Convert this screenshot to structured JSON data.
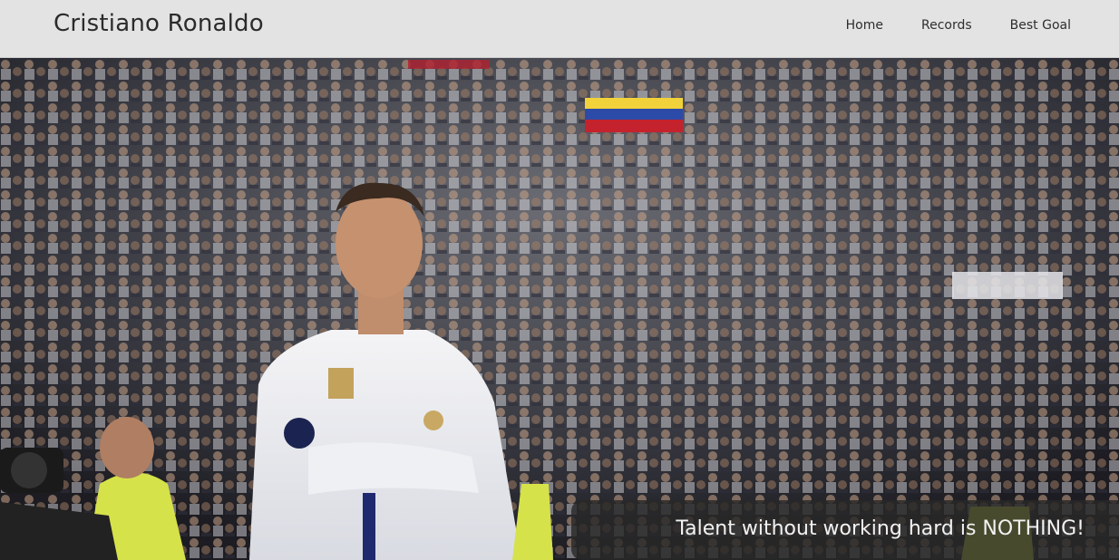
{
  "navbar": {
    "brand": "Cristiano Ronaldo",
    "links": [
      {
        "label": "Home"
      },
      {
        "label": "Records"
      },
      {
        "label": "Best Goal"
      }
    ]
  },
  "hero": {
    "image_description_icon": "stadium-photo",
    "quote": "Talent without working hard is NOTHING!"
  },
  "colors": {
    "navbar_bg": "#e3e3e3",
    "brand_text": "#2b2b2b",
    "banner_bg": "#282828",
    "banner_text": "#f2f2f2"
  }
}
